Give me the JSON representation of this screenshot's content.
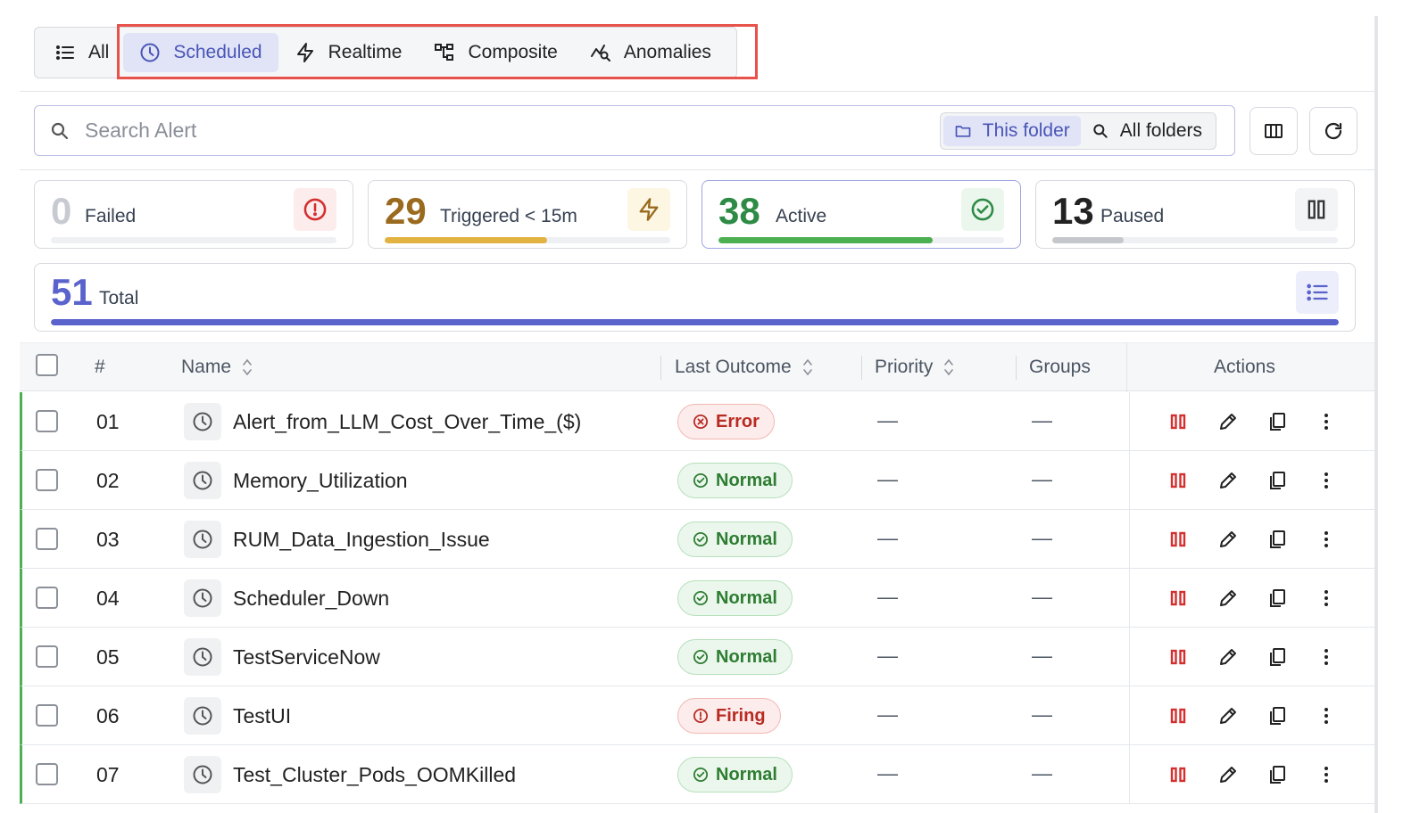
{
  "tabs": [
    {
      "label": "All",
      "icon": "list-icon"
    },
    {
      "label": "Scheduled",
      "icon": "clock-icon"
    },
    {
      "label": "Realtime",
      "icon": "lightning-icon"
    },
    {
      "label": "Composite",
      "icon": "hierarchy-icon"
    },
    {
      "label": "Anomalies",
      "icon": "anomaly-icon"
    }
  ],
  "active_tab": "Scheduled",
  "search": {
    "placeholder": "Search Alert",
    "value": ""
  },
  "folder_toggle": {
    "this_folder": "This folder",
    "all_folders": "All folders",
    "selected": "This folder"
  },
  "stats": {
    "failed": {
      "value": "0",
      "label": "Failed",
      "progress": 0
    },
    "triggered": {
      "value": "29",
      "label": "Triggered < 15m",
      "progress": 0.57
    },
    "active": {
      "value": "38",
      "label": "Active",
      "progress": 0.75
    },
    "paused": {
      "value": "13",
      "label": "Paused",
      "progress": 0.25
    },
    "total": {
      "value": "51",
      "label": "Total",
      "progress": 1.0
    }
  },
  "colors": {
    "accent": "#5a63cc",
    "failed": "#d32f2f",
    "triggered": "#9a6a1f",
    "triggered_bar": "#e3b341",
    "active": "#2e8b45",
    "active_bar": "#4caf50",
    "paused": "#222222",
    "paused_bar": "#c4c7cc",
    "error": "#b72b22",
    "normal": "#2e7d32"
  },
  "table": {
    "columns": {
      "index": "#",
      "name": "Name",
      "last_outcome": "Last Outcome",
      "priority": "Priority",
      "groups": "Groups",
      "actions": "Actions"
    },
    "rows": [
      {
        "num": "01",
        "name": "Alert_from_LLM_Cost_Over_Time_($)",
        "outcome": "Error",
        "status": "error",
        "priority": "—",
        "groups": "—"
      },
      {
        "num": "02",
        "name": "Memory_Utilization",
        "outcome": "Normal",
        "status": "normal",
        "priority": "—",
        "groups": "—"
      },
      {
        "num": "03",
        "name": "RUM_Data_Ingestion_Issue",
        "outcome": "Normal",
        "status": "normal",
        "priority": "—",
        "groups": "—"
      },
      {
        "num": "04",
        "name": "Scheduler_Down",
        "outcome": "Normal",
        "status": "normal",
        "priority": "—",
        "groups": "—"
      },
      {
        "num": "05",
        "name": "TestServiceNow",
        "outcome": "Normal",
        "status": "normal",
        "priority": "—",
        "groups": "—"
      },
      {
        "num": "06",
        "name": "TestUI",
        "outcome": "Firing",
        "status": "error",
        "priority": "—",
        "groups": "—"
      },
      {
        "num": "07",
        "name": "Test_Cluster_Pods_OOMKilled",
        "outcome": "Normal",
        "status": "normal",
        "priority": "—",
        "groups": "—"
      }
    ]
  }
}
